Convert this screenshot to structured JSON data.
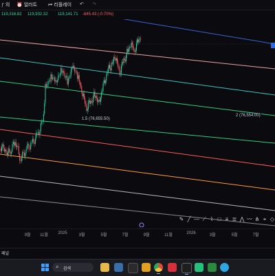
{
  "toolbar": {
    "indicator_label": "의",
    "alert_label": "얼러트",
    "replay_label": "리플레이",
    "undo_icon": "undo-icon",
    "redo_icon": "redo-icon"
  },
  "info_line": {
    "open": "119,316.82",
    "high": "119,932.32",
    "close": "119,141.71",
    "change": "-845.43 (-0.70%)",
    "color_up": "#2bd4a4",
    "color_down": "#ff5e6a"
  },
  "fib_labels": {
    "level_1_5": "1.5 (76,655.50)",
    "level_2": "2 (76,554.00)"
  },
  "x_axis": {
    "ticks": [
      "9월",
      "11월",
      "2025",
      "3월",
      "5월",
      "7월",
      "9월",
      "11월",
      "2026",
      "3월",
      "5월",
      "7월"
    ]
  },
  "panel_title": "패널",
  "taskbar": {
    "search_label": "검색",
    "apps": [
      "file-explorer",
      "browser-app",
      "media-app",
      "chrome",
      "app-red",
      "app-dark",
      "kakao",
      "app-green",
      "telegram"
    ]
  },
  "colors": {
    "background": "#0b0b0f",
    "candle_up": "#2bd4a4",
    "candle_down": "#ff5e6a",
    "fib_lines": [
      "#3d63d9",
      "#f0a3a3",
      "#3fc0c0",
      "#2fcf86",
      "#2fcf86",
      "#ff5a5a",
      "#ff9c3a",
      "#bcbcbc",
      "#8a8a8a"
    ]
  }
}
